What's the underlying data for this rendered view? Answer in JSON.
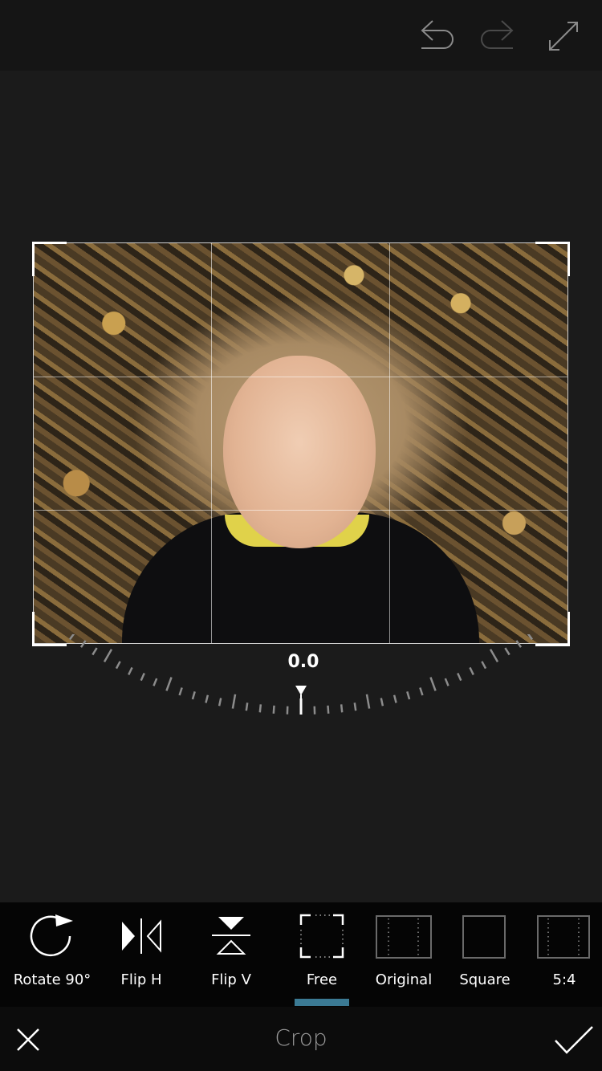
{
  "header": {
    "icons": [
      {
        "name": "undo-icon",
        "enabled": true
      },
      {
        "name": "redo-icon",
        "enabled": false
      },
      {
        "name": "expand-icon",
        "enabled": true
      }
    ]
  },
  "straighten": {
    "angle_value": "0.0",
    "angle_degrees": 0
  },
  "tools": [
    {
      "id": "rotate",
      "label": "Rotate 90°",
      "icon": "rotate-icon"
    },
    {
      "id": "flip-h",
      "label": "Flip H",
      "icon": "flip-horizontal-icon"
    },
    {
      "id": "flip-v",
      "label": "Flip V",
      "icon": "flip-vertical-icon"
    },
    {
      "id": "free",
      "label": "Free",
      "icon": "free-crop-icon",
      "selected": true
    },
    {
      "id": "original",
      "label": "Original",
      "icon": "original-ratio-icon"
    },
    {
      "id": "square",
      "label": "Square",
      "icon": "square-ratio-icon"
    },
    {
      "id": "five-four",
      "label": "5:4",
      "icon": "ratio-5-4-icon"
    }
  ],
  "bottom": {
    "title": "Crop",
    "cancel_icon": "close-icon",
    "confirm_icon": "checkmark-icon"
  },
  "colors": {
    "accent": "#3b7a94",
    "background": "#1b1b1b",
    "toolbar": "#050505"
  }
}
